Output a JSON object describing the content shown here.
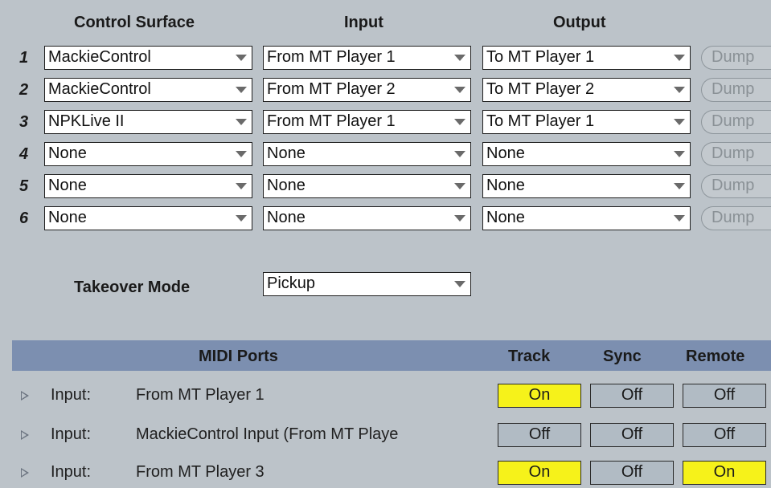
{
  "headers": {
    "control_surface": "Control Surface",
    "input": "Input",
    "output": "Output"
  },
  "rows": [
    {
      "num": "1",
      "surface": "MackieControl",
      "input": "From MT Player 1",
      "output": "To MT Player 1",
      "dump": "Dump"
    },
    {
      "num": "2",
      "surface": "MackieControl",
      "input": "From MT Player 2",
      "output": "To MT Player 2",
      "dump": "Dump"
    },
    {
      "num": "3",
      "surface": "NPKLive II",
      "input": "From MT Player 1",
      "output": "To MT Player 1",
      "dump": "Dump"
    },
    {
      "num": "4",
      "surface": "None",
      "input": "None",
      "output": "None",
      "dump": "Dump"
    },
    {
      "num": "5",
      "surface": "None",
      "input": "None",
      "output": "None",
      "dump": "Dump"
    },
    {
      "num": "6",
      "surface": "None",
      "input": "None",
      "output": "None",
      "dump": "Dump"
    }
  ],
  "takeover": {
    "label": "Takeover Mode",
    "value": "Pickup"
  },
  "midi_ports": {
    "header": "MIDI Ports",
    "col_track": "Track",
    "col_sync": "Sync",
    "col_remote": "Remote",
    "ports": [
      {
        "type": "Input:",
        "name": "From MT Player 1",
        "track": "On",
        "sync": "Off",
        "remote": "Off"
      },
      {
        "type": "Input:",
        "name": "MackieControl Input (From MT Playe",
        "track": "Off",
        "sync": "Off",
        "remote": "Off"
      },
      {
        "type": "Input:",
        "name": "From MT Player 3",
        "track": "On",
        "sync": "Off",
        "remote": "On"
      }
    ]
  },
  "colors": {
    "background": "#bcc3c9",
    "header_band": "#7c8fb0",
    "toggle_on": "#f6f21a",
    "toggle_off": "#b1bbc4"
  }
}
